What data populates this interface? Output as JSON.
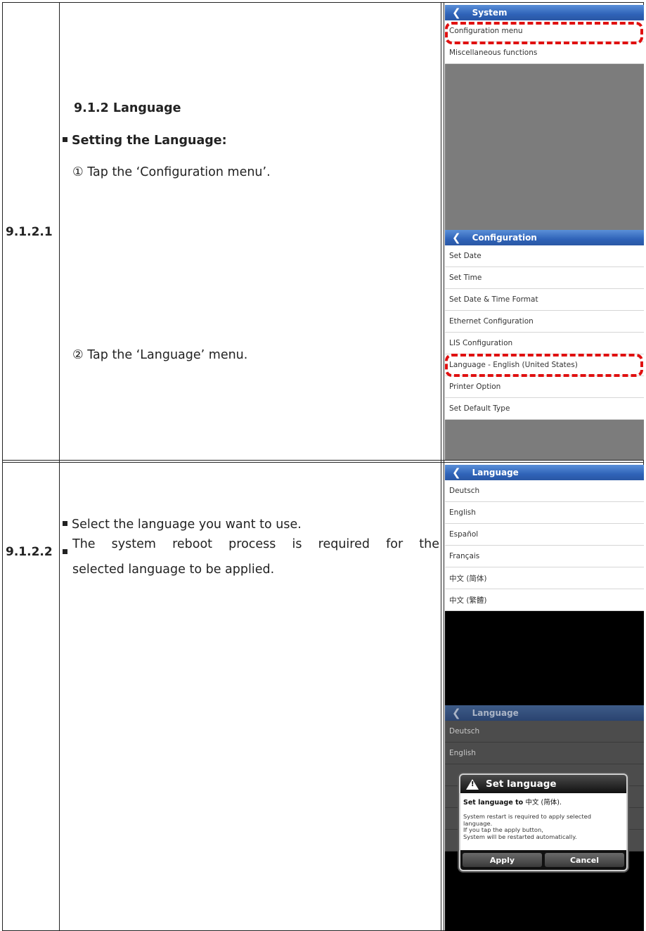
{
  "row1": {
    "id": "9.1.2.1",
    "section_title": "9.1.2 Language",
    "subheading": "Setting the Language:",
    "step1": "① Tap the ‘Configuration menu’.",
    "step2": "② Tap the ‘Language’ menu."
  },
  "row2": {
    "id": "9.1.2.2",
    "bullet1": "Select the language you want to use.",
    "bullet2_line1": "The system reboot process is required for the",
    "bullet2_line2": "selected language to be applied."
  },
  "screens": {
    "system": {
      "title": "System",
      "items": [
        "Configuration menu",
        "Miscellaneous functions"
      ]
    },
    "configuration": {
      "title": "Configuration",
      "items": [
        "Set Date",
        "Set Time",
        "Set Date & Time Format",
        "Ethernet Configuration",
        "LIS Configuration",
        "Language - English (United States)",
        "Printer Option",
        "Set Default Type"
      ]
    },
    "language": {
      "title": "Language",
      "items": [
        "Deutsch",
        "English",
        "Español",
        "Français",
        "中文 (简体)",
        "中文 (繁體)"
      ]
    },
    "language_dialog": {
      "title": "Language",
      "bg_items": [
        "Deutsch",
        "English"
      ],
      "dialog": {
        "title": "Set language",
        "line1_prefix": "Set language to",
        "line1_value": "中文 (简体).",
        "body": [
          "System restart is required to apply selected",
          "language.",
          "If you tap the apply button,",
          "System will be restarted automatically."
        ],
        "apply_label": "Apply",
        "cancel_label": "Cancel"
      }
    }
  },
  "colors": {
    "titlebar": "#2f63b8",
    "highlight": "#e01010",
    "gray_area": "#7c7c7c"
  }
}
